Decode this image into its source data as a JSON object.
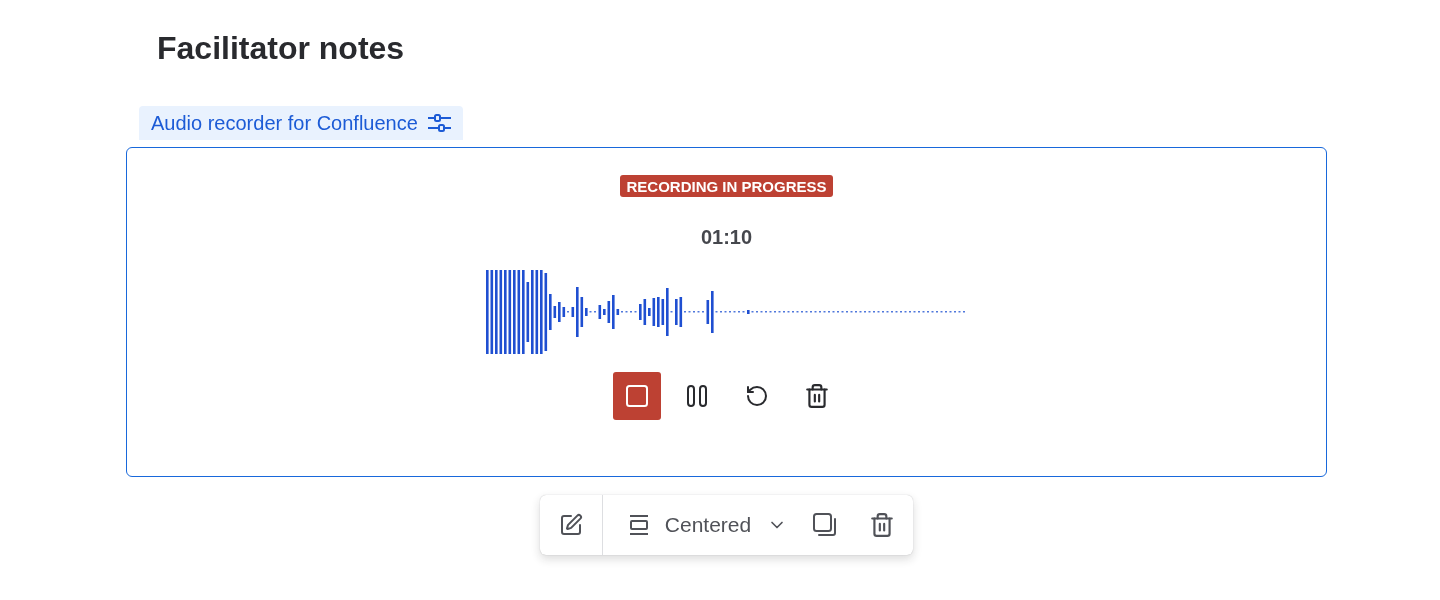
{
  "page": {
    "title": "Facilitator notes"
  },
  "macro_label": {
    "text": "Audio recorder for Confluence"
  },
  "recorder": {
    "status": "RECORDING IN PROGRESS",
    "time": "01:10"
  },
  "toolbar": {
    "layout": "Centered"
  }
}
